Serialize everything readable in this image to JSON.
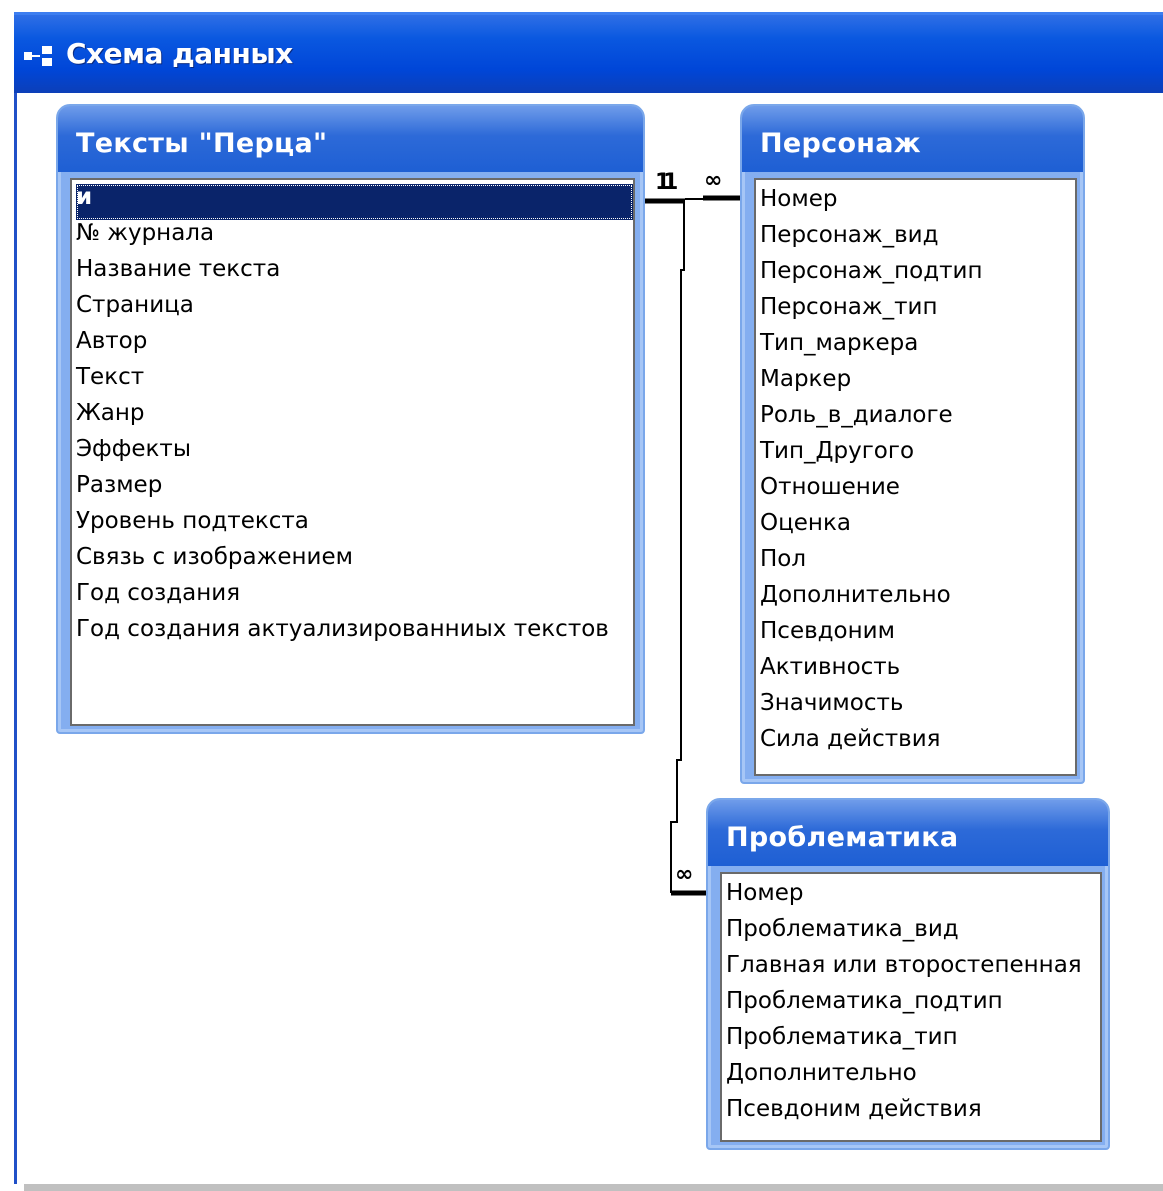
{
  "window": {
    "title": "Схема данных"
  },
  "tables": {
    "texts": {
      "title": "Тексты \"Перца\"",
      "fields": [
        "и",
        "№ журнала",
        "Название текста",
        "Страница",
        "Автор",
        "Текст",
        "Жанр",
        "Эффекты",
        "Размер",
        "Уровень подтекста",
        "Связь с изображением",
        "Год создания",
        "Год создания актуализированниых текстов"
      ]
    },
    "character": {
      "title": "Персонаж",
      "fields": [
        "Номер",
        "Персонаж_вид",
        "Персонаж_подтип",
        "Персонаж_тип",
        "Тип_маркера",
        "Маркер",
        "Роль_в_диалоге",
        "Тип_Другого",
        "Отношение",
        "Оценка",
        "Пол",
        "Дополнительно",
        "Псевдоним",
        "Активность",
        "Значимость",
        "Сила действия"
      ]
    },
    "problems": {
      "title": "Проблематика",
      "fields": [
        "Номер",
        "Проблематика_вид",
        "Главная или второстепенная",
        "Проблематика_подтип",
        "Проблематика_тип",
        "Дополнительно",
        "Псевдоним действия"
      ]
    }
  },
  "relationships": {
    "one_label": "1",
    "many_label": "∞"
  },
  "selected_field": "и"
}
